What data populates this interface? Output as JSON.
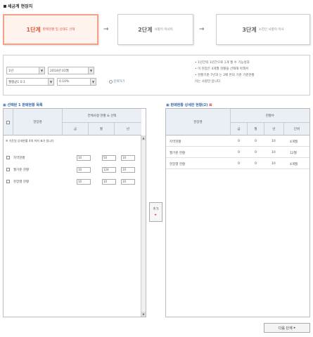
{
  "page": {
    "title": "세금계 현장지"
  },
  "steps": [
    {
      "num": "1단계",
      "desc": "판매현황 및 상태도 선택"
    },
    {
      "num": "2단계",
      "desc": "사항이 이사이"
    },
    {
      "num": "3단계",
      "desc": "소진인 사항이 이사"
    }
  ],
  "filters": {
    "select1": "1년",
    "select2": "2014년 01월",
    "select3": "월평균1 0.1",
    "select4": "0.10%",
    "search_label": "검색하기",
    "notes": [
      "• 1년간의 1년간으로 1개 월 수 기능성과",
      "• 이 현장은 4개월 현황을 선택해 아래서",
      "• 현황기준 7년과 는 2배 번의 기준 기준현황",
      "  이는 사항만 얻니다."
    ]
  },
  "left_panel": {
    "heading": "▣ 선택된 1 판매현황 목록",
    "header_name": "현장명",
    "header_group": "전체사항 현황 & 선택",
    "sub_headers": [
      "금",
      "월",
      "년"
    ],
    "notice": "※ 기준일 상세현황 4개 까지 표기 됩니다",
    "rows": [
      {
        "name": "지역현황",
        "v1": "10",
        "v2": "50",
        "v3": "10"
      },
      {
        "name": "월기준 현황",
        "v1": "10",
        "v2": "124",
        "v3": "10"
      },
      {
        "name": "현장별 현황",
        "v1": "10",
        "v2": "10",
        "v3": "10"
      }
    ]
  },
  "right_panel": {
    "heading": "▣ 판매현황 상세한 현황(2) ",
    "heading_mark": "⊠",
    "header_name": "현장명",
    "header_group": "현황수",
    "sub_headers": [
      "금",
      "월",
      "년",
      "단위"
    ],
    "rows": [
      {
        "name": "지역현황",
        "v1": "0",
        "v2": "0",
        "v3": "10",
        "v4": "4개월"
      },
      {
        "name": "월기준 현황",
        "v1": "0",
        "v2": "0",
        "v3": "10",
        "v4": "12월"
      },
      {
        "name": "현장별 현황",
        "v1": "0",
        "v2": "0",
        "v3": "10",
        "v4": "4개월"
      }
    ]
  },
  "move_button": {
    "label": "추가",
    "arrow": "▸"
  },
  "bottom_button": {
    "label": "다음 단계",
    "arrow": "▸"
  },
  "colors": {
    "accent": "#d85a3b",
    "header_bg": "#e9eff5",
    "link": "#3366aa"
  }
}
